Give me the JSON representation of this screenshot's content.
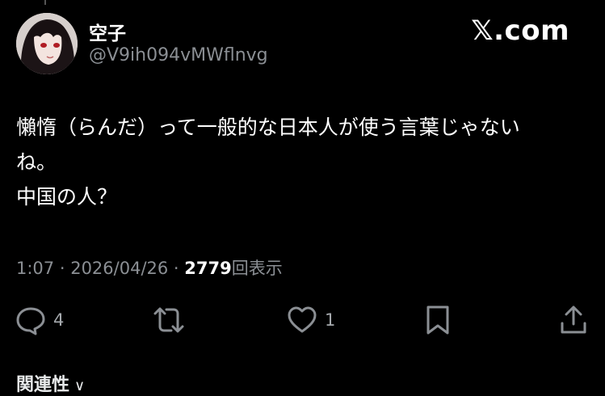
{
  "author": {
    "display_name": "空子",
    "handle": "@V9ih094vMWflnvg"
  },
  "brand": {
    "logo_text": ".com",
    "logo_mark": "𝕏"
  },
  "tweet": {
    "lines": [
      "懶惰（らんだ）って一般的な日本人が使う言葉じゃない",
      "ね。",
      "中国の人？"
    ]
  },
  "meta": {
    "time": "1:07",
    "separator": " · ",
    "date": "2026/04/26",
    "views_count": "2779",
    "views_label": "回表示"
  },
  "actions": {
    "reply_count": "4",
    "like_count": "1",
    "reply_icon": "reply-icon",
    "retweet_icon": "retweet-icon",
    "like_icon": "heart-icon",
    "bookmark_icon": "bookmark-icon",
    "share_icon": "share-icon"
  },
  "related": {
    "label": "関連性",
    "chevron": "∨"
  },
  "colors": {
    "background": "#000000",
    "text": "#ffffff",
    "muted": "#8b8f94"
  }
}
